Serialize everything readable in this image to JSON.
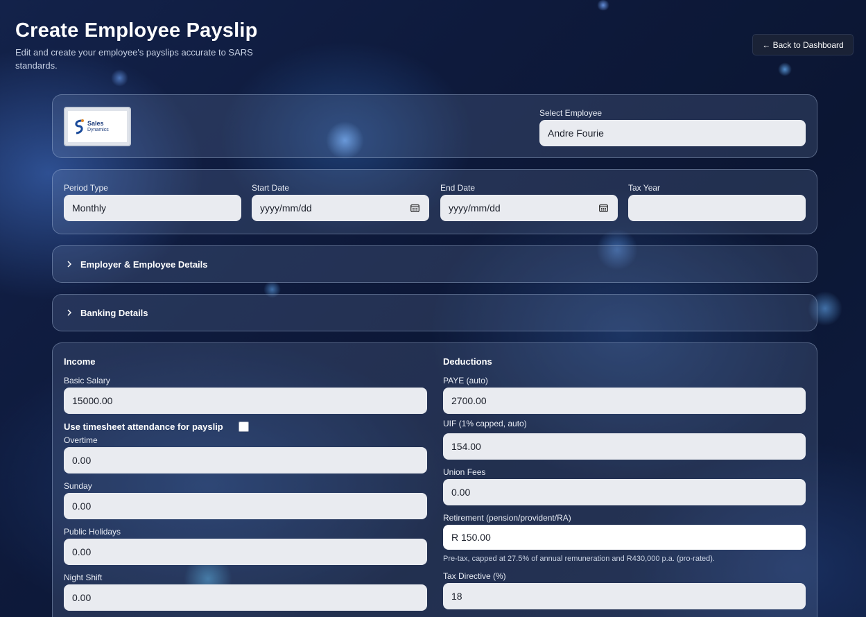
{
  "header": {
    "title": "Create Employee Payslip",
    "subtitle": "Edit and create your employee's payslips accurate to SARS standards.",
    "back_button": "← Back to Dashboard"
  },
  "company": {
    "logo_name": "Sales",
    "logo_name2": "Dynamics",
    "employee_label": "Select Employee",
    "employee_value": "Andre Fourie"
  },
  "period": {
    "period_type_label": "Period Type",
    "period_type_value": "Monthly",
    "start_label": "Start Date",
    "start_placeholder": "yyyy/mm/dd",
    "end_label": "End Date",
    "end_placeholder": "yyyy/mm/dd",
    "tax_year_label": "Tax Year",
    "tax_year_value": ""
  },
  "accordions": {
    "employer": "Employer & Employee Details",
    "banking": "Banking Details"
  },
  "income": {
    "heading": "Income",
    "basic_label": "Basic Salary",
    "basic_value": "15000.00",
    "timesheet_label": "Use timesheet attendance for payslip",
    "overtime_label": "Overtime",
    "overtime_value": "0.00",
    "sunday_label": "Sunday",
    "sunday_value": "0.00",
    "public_label": "Public Holidays",
    "public_value": "0.00",
    "night_label": "Night Shift",
    "night_value": "0.00"
  },
  "deductions": {
    "heading": "Deductions",
    "paye_label": "PAYE (auto)",
    "paye_value": "2700.00",
    "uif_label": "UIF (1% capped, auto)",
    "uif_value": "154.00",
    "union_label": "Union Fees",
    "union_value": "0.00",
    "retirement_label": "Retirement (pension/provident/RA)",
    "retirement_value": "R 150.00",
    "retirement_hint": "Pre-tax, capped at 27.5% of annual remuneration and R430,000 p.a. (pro-rated).",
    "tax_directive_label": "Tax Directive (%)",
    "tax_directive_value": "18"
  }
}
